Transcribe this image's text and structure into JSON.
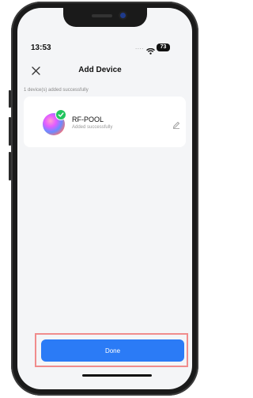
{
  "status_bar": {
    "time": "13:53",
    "signal_indicator": "....",
    "battery": "73",
    "icons": [
      "wifi-icon"
    ]
  },
  "header": {
    "title": "Add Device",
    "close_icon": "close-icon"
  },
  "result": {
    "success_count": "1 device(s) added successfully"
  },
  "device": {
    "name": "RF-POOL",
    "status": "Added successfully",
    "icons": [
      "check-icon",
      "edit-icon"
    ]
  },
  "footer": {
    "done_label": "Done"
  },
  "colors": {
    "accent": "#2b7bf6",
    "success": "#22c55e",
    "highlight": "#f08c8c",
    "background": "#f4f5f7"
  }
}
